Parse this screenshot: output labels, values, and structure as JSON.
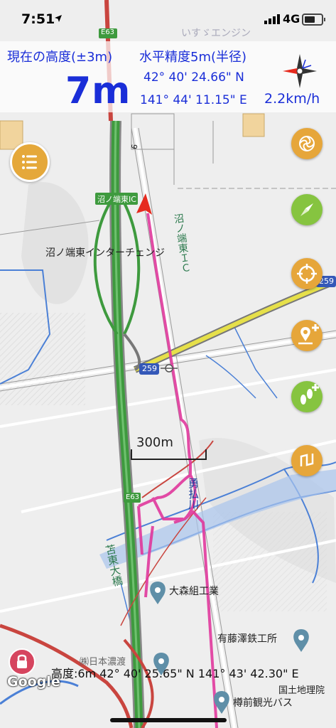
{
  "status_bar": {
    "time": "7:51",
    "network": "4G"
  },
  "info": {
    "altitude_label": "現在の高度(±3m)",
    "altitude_value": "7m",
    "accuracy_label": "水平精度5m(半径)",
    "latitude": "42° 40' 24.66\" N",
    "longitude": "141° 44' 11.15\" E",
    "speed": "2.2km/h"
  },
  "map": {
    "labels": {
      "interchange_badge": "沼ノ端東IC",
      "interchange_name": "沼ノ端東インターチェンジ",
      "interchange_vertical": "沼ノ端東ＩＣ",
      "route_259_right": "259",
      "route_259_center": "259",
      "highway_top": "E63",
      "highway_mid": "E63",
      "bridge": "苫東大橋",
      "river": "勇払川",
      "poi_1": "大森組工業",
      "poi_2": "有藤澤鉄工所",
      "poi_3": "㈱日本濃渡",
      "poi_4": "樽前観光バス",
      "top_faded": "いすゞエンジン",
      "km_post": "6"
    },
    "scale_label": "300m",
    "colors": {
      "track": "#e0389c",
      "highway": "#3e9a3e",
      "route": "#e6e04a",
      "water": "#4b80d6",
      "heading": "#e62a1e"
    }
  },
  "buttons": {
    "menu": "menu-icon",
    "right": [
      "pinwheel-icon",
      "compass-icon",
      "crosshair-icon",
      "add-place-icon",
      "add-footprints-icon",
      "route-icon"
    ]
  },
  "footer": {
    "coords": "高度:6m  42° 40' 25.65\" N 141° 43' 42.30\" E",
    "attribution": "国土地理院",
    "google": "Google"
  }
}
